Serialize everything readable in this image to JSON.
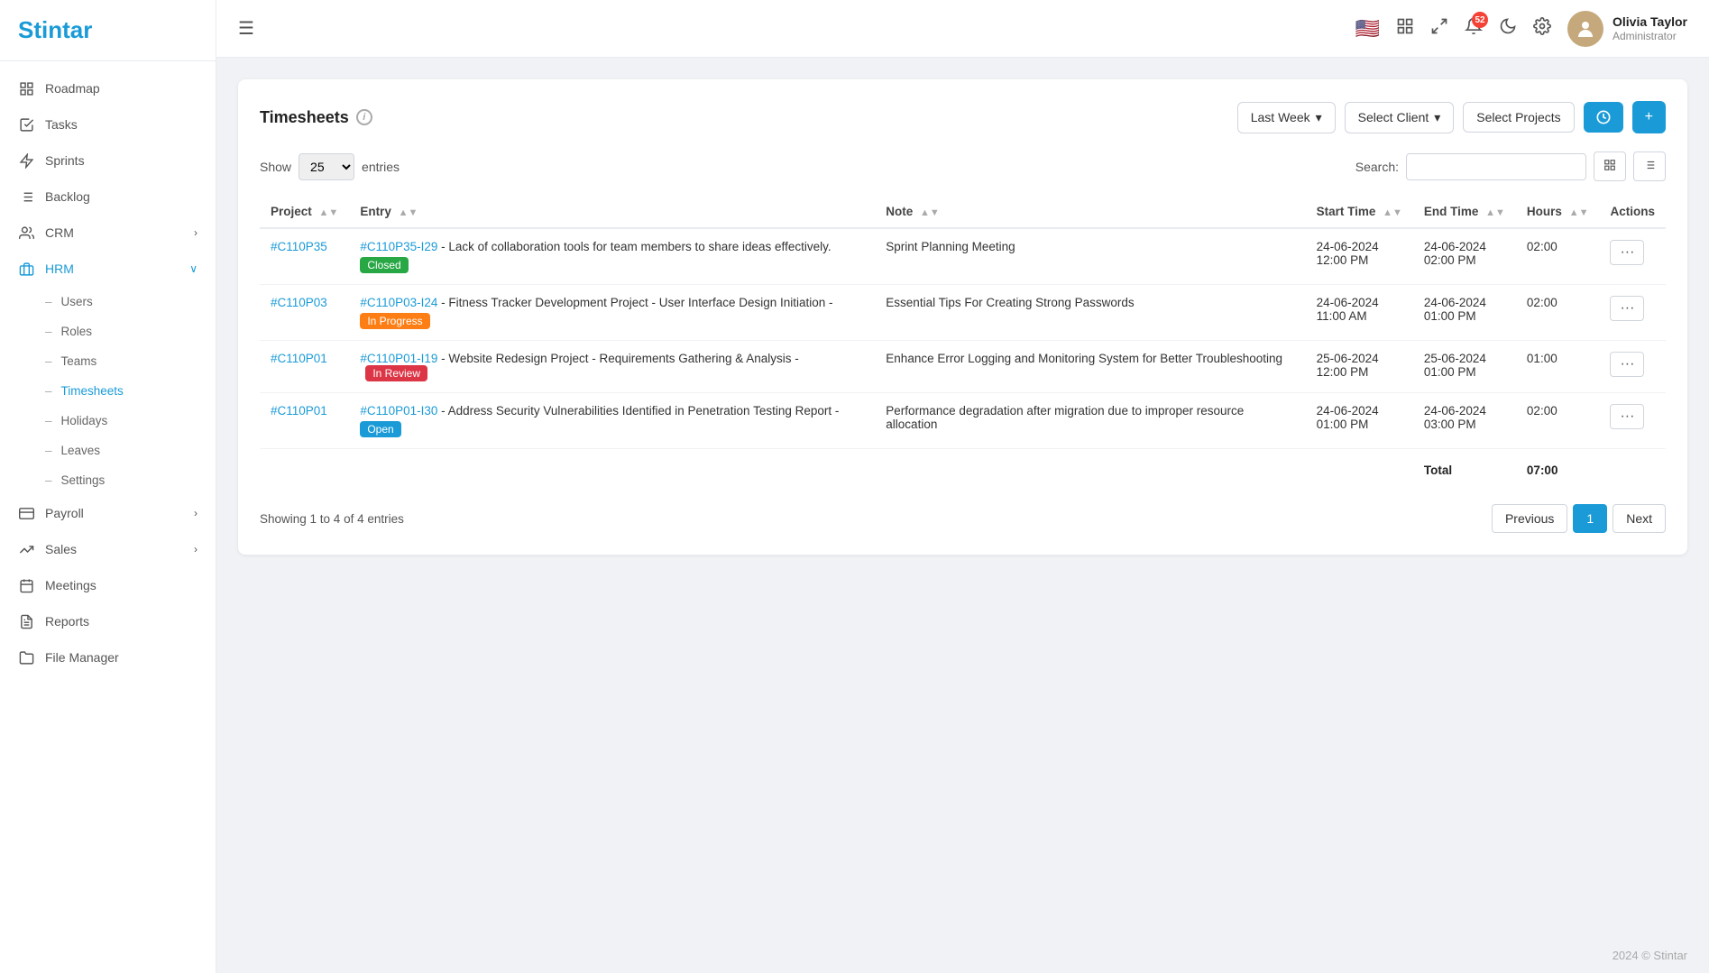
{
  "sidebar": {
    "logo": "Stintar",
    "items": [
      {
        "id": "roadmap",
        "label": "Roadmap",
        "icon": "📊",
        "has_arrow": false
      },
      {
        "id": "tasks",
        "label": "Tasks",
        "icon": "☑",
        "has_arrow": false
      },
      {
        "id": "sprints",
        "label": "Sprints",
        "icon": "⚡",
        "has_arrow": false
      },
      {
        "id": "backlog",
        "label": "Backlog",
        "icon": "📋",
        "has_arrow": false
      },
      {
        "id": "crm",
        "label": "CRM",
        "icon": "👤",
        "has_arrow": true
      },
      {
        "id": "hrm",
        "label": "HRM",
        "icon": "🏢",
        "has_arrow": true,
        "active": true
      },
      {
        "id": "payroll",
        "label": "Payroll",
        "icon": "💰",
        "has_arrow": true
      },
      {
        "id": "sales",
        "label": "Sales",
        "icon": "📈",
        "has_arrow": true
      },
      {
        "id": "meetings",
        "label": "Meetings",
        "icon": "📅",
        "has_arrow": false
      },
      {
        "id": "reports",
        "label": "Reports",
        "icon": "📊",
        "has_arrow": false
      },
      {
        "id": "file-manager",
        "label": "File Manager",
        "icon": "📁",
        "has_arrow": false
      }
    ],
    "hrm_sub_items": [
      {
        "id": "users",
        "label": "Users"
      },
      {
        "id": "roles",
        "label": "Roles"
      },
      {
        "id": "teams",
        "label": "Teams"
      },
      {
        "id": "timesheets",
        "label": "Timesheets",
        "active": true
      },
      {
        "id": "holidays",
        "label": "Holidays"
      },
      {
        "id": "leaves",
        "label": "Leaves"
      },
      {
        "id": "settings",
        "label": "Settings"
      }
    ]
  },
  "header": {
    "notification_count": "52",
    "user": {
      "name": "Olivia Taylor",
      "role": "Administrator"
    }
  },
  "timesheets": {
    "title": "Timesheets",
    "filters": {
      "period": "Last Week",
      "client_placeholder": "Select Client",
      "project_placeholder": "Select Projects"
    },
    "table_controls": {
      "show_label": "Show",
      "entries_label": "entries",
      "show_value": "25",
      "search_label": "Search:",
      "search_placeholder": ""
    },
    "columns": [
      {
        "id": "project",
        "label": "Project"
      },
      {
        "id": "entry",
        "label": "Entry"
      },
      {
        "id": "note",
        "label": "Note"
      },
      {
        "id": "start_time",
        "label": "Start Time"
      },
      {
        "id": "end_time",
        "label": "End Time"
      },
      {
        "id": "hours",
        "label": "Hours"
      },
      {
        "id": "actions",
        "label": "Actions"
      }
    ],
    "rows": [
      {
        "project": "#C110P35",
        "entry_id": "#C110P35-I29",
        "entry_desc": "Lack of collaboration tools for team members to share ideas effectively.",
        "entry_status": "Closed",
        "entry_badge": "closed",
        "note": "Sprint Planning Meeting",
        "start_time": "24-06-2024\n12:00 PM",
        "end_time": "24-06-2024\n02:00 PM",
        "hours": "02:00"
      },
      {
        "project": "#C110P03",
        "entry_id": "#C110P03-I24",
        "entry_desc": "Fitness Tracker Development Project - User Interface Design Initiation -",
        "entry_status": "In Progress",
        "entry_badge": "in-progress",
        "note": "Essential Tips For Creating Strong Passwords",
        "start_time": "24-06-2024\n11:00 AM",
        "end_time": "24-06-2024\n01:00 PM",
        "hours": "02:00"
      },
      {
        "project": "#C110P01",
        "entry_id": "#C110P01-I19",
        "entry_desc": "Website Redesign Project - Requirements Gathering & Analysis -",
        "entry_status": "In Review",
        "entry_badge": "in-review",
        "note": "Enhance Error Logging and Monitoring System for Better Troubleshooting",
        "start_time": "25-06-2024\n12:00 PM",
        "end_time": "25-06-2024\n01:00 PM",
        "hours": "01:00"
      },
      {
        "project": "#C110P01",
        "entry_id": "#C110P01-I30",
        "entry_desc": "Address Security Vulnerabilities Identified in Penetration Testing Report -",
        "entry_status": "Open",
        "entry_badge": "open",
        "note": "Performance degradation after migration due to improper resource allocation",
        "start_time": "24-06-2024\n01:00 PM",
        "end_time": "24-06-2024\n03:00 PM",
        "hours": "02:00"
      }
    ],
    "total_label": "Total",
    "total_hours": "07:00",
    "pagination": {
      "showing_text": "Showing 1 to 4 of 4 entries",
      "previous_label": "Previous",
      "next_label": "Next",
      "current_page": "1"
    }
  },
  "footer": {
    "text": "2024 © Stintar"
  }
}
